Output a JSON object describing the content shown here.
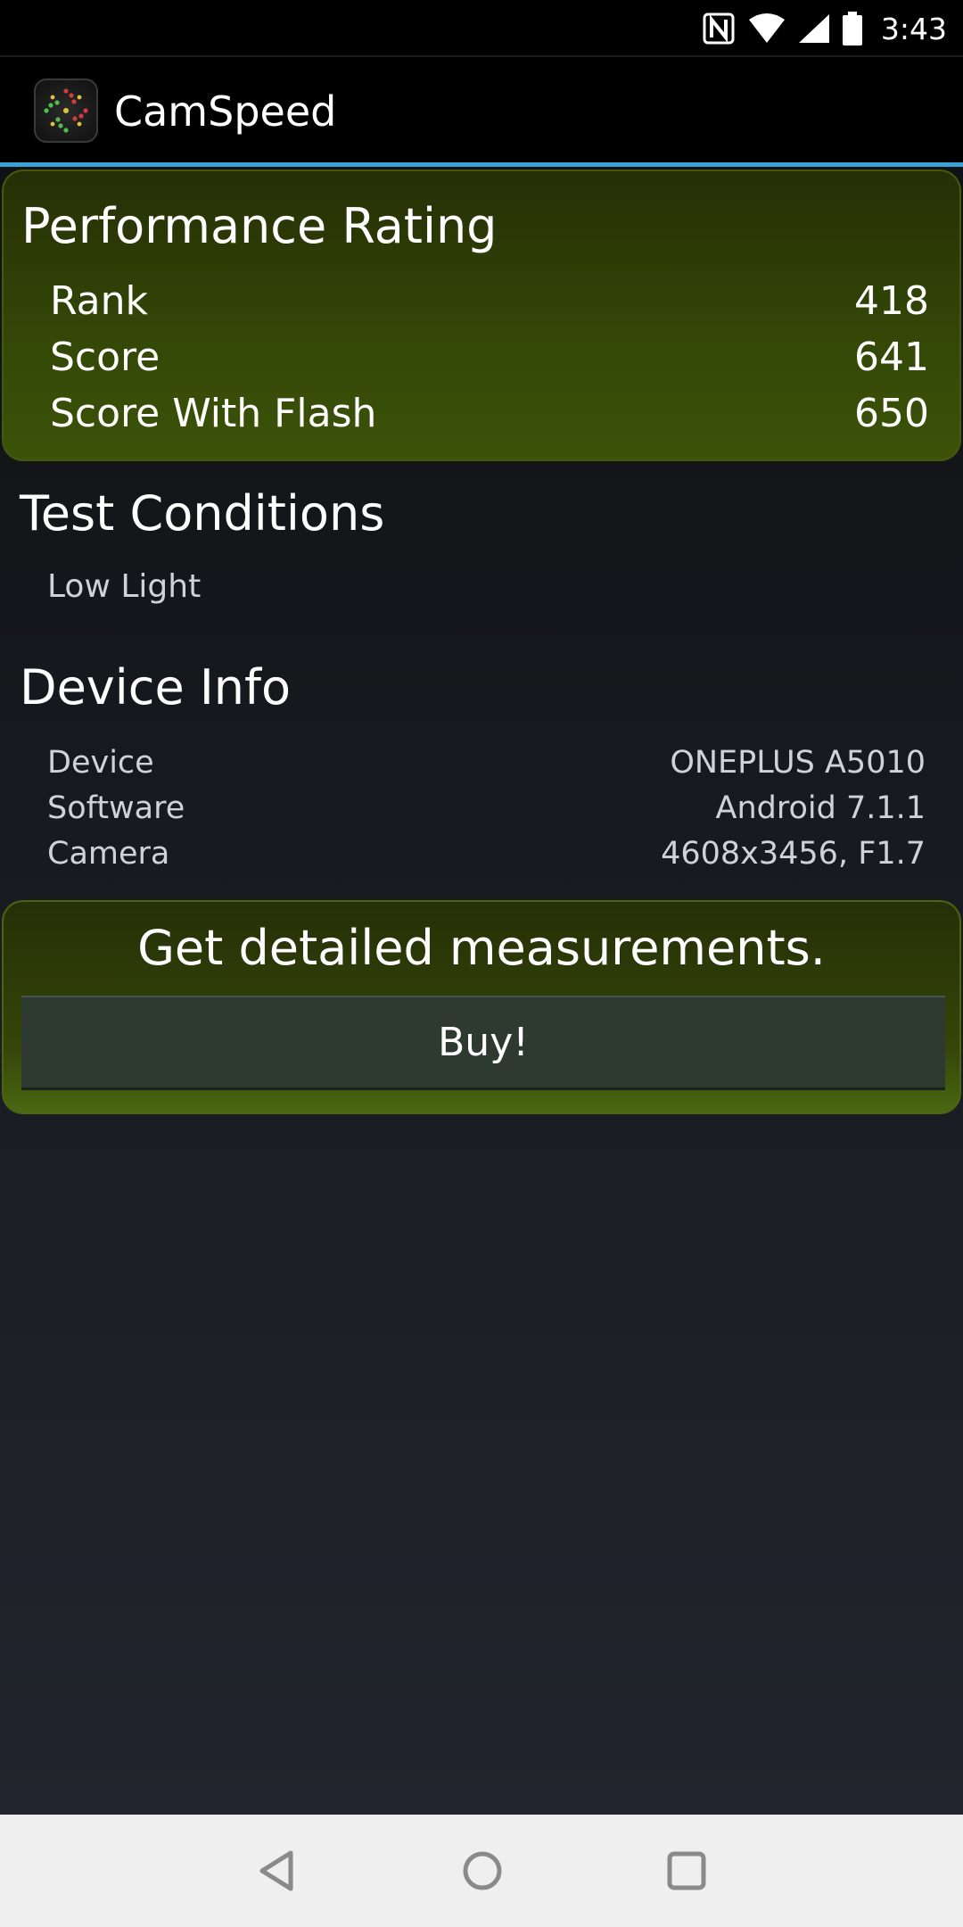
{
  "status_bar": {
    "time": "3:43",
    "icons": [
      "nfc-icon",
      "wifi-icon",
      "signal-icon",
      "battery-icon"
    ]
  },
  "app_bar": {
    "title": "CamSpeed",
    "app_icon": "camspeed-logo-icon"
  },
  "performance": {
    "title": "Performance Rating",
    "rows": [
      {
        "label": "Rank",
        "value": "418"
      },
      {
        "label": "Score",
        "value": "641"
      },
      {
        "label": "Score With Flash",
        "value": "650"
      }
    ]
  },
  "test_conditions": {
    "title": "Test Conditions",
    "value": "Low Light"
  },
  "device_info": {
    "title": "Device Info",
    "rows": [
      {
        "label": "Device",
        "value": "ONEPLUS A5010"
      },
      {
        "label": "Software",
        "value": "Android 7.1.1"
      },
      {
        "label": "Camera",
        "value": "4608x3456, F1.7"
      }
    ]
  },
  "promo": {
    "headline": "Get detailed measurements.",
    "button_label": "Buy!"
  },
  "nav_bar": {
    "icons": [
      "back-icon",
      "home-icon",
      "recents-icon"
    ]
  },
  "colors": {
    "accent_line": "#3aa3d6",
    "card_green": "#344807",
    "background": "#101114"
  }
}
